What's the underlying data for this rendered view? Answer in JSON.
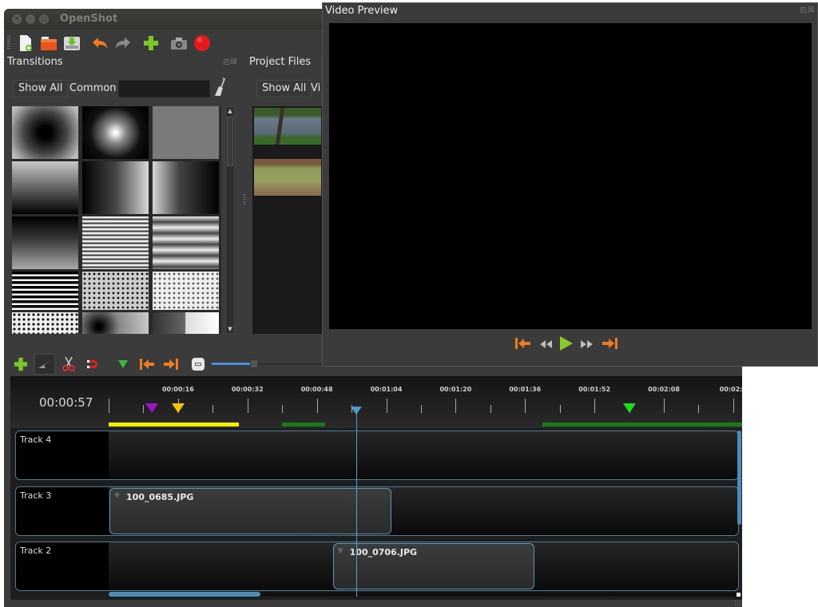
{
  "main_window": {
    "title": "OpenShot",
    "window_buttons": [
      "close",
      "minimize",
      "maximize"
    ],
    "toolbar": [
      {
        "name": "new-project-icon",
        "glyph": "📄"
      },
      {
        "name": "open-project-icon",
        "glyph": "📂"
      },
      {
        "name": "save-project-icon",
        "glyph": "⬇"
      },
      {
        "name": "undo-icon",
        "glyph": "↶"
      },
      {
        "name": "redo-icon",
        "glyph": "↷"
      },
      {
        "name": "import-files-icon",
        "glyph": "✚"
      },
      {
        "name": "export-snapshot-icon",
        "glyph": "📷"
      },
      {
        "name": "export-video-icon",
        "glyph": "●"
      }
    ]
  },
  "transitions_panel": {
    "title": "Transitions",
    "filter_show_all": "Show All",
    "filter_common": "Common",
    "search_value": "",
    "clear_icon": "broom-icon"
  },
  "project_files_panel": {
    "title": "Project Files",
    "filter_show_all": "Show All",
    "filter_video_truncated": "Vi",
    "files": [
      "pond-scene",
      "field-fence-scene"
    ]
  },
  "video_preview": {
    "title": "Video Preview",
    "controls": [
      "jump-to-start",
      "rewind",
      "play",
      "fast-forward",
      "jump-to-end"
    ]
  },
  "timeline_toolbar": {
    "zoom_level": 0.35
  },
  "timeline": {
    "current_time": "00:00:57",
    "playhead_seconds": 57,
    "ruler_labels": [
      "00:00:16",
      "00:00:32",
      "00:00:48",
      "00:01:04",
      "00:01:20",
      "00:01:36",
      "00:01:52",
      "00:02:08",
      "00:02:2"
    ],
    "ruler_label_seconds": [
      16,
      32,
      48,
      64,
      80,
      96,
      112,
      128,
      144
    ],
    "markers": [
      {
        "seconds": 10,
        "color": "#9b14c8"
      },
      {
        "seconds": 16,
        "color": "#f5c400"
      },
      {
        "seconds": 120,
        "color": "#19e01e"
      }
    ],
    "ranges": [
      {
        "start": 0,
        "end": 30,
        "color": "#f5f000"
      },
      {
        "start": 40,
        "end": 50,
        "color": "#1a7a1a"
      },
      {
        "start": 100,
        "end": 146,
        "color": "#1a7a1a"
      }
    ],
    "tracks": [
      {
        "name": "Track 4",
        "clips": []
      },
      {
        "name": "Track 3",
        "clips": [
          {
            "name": "100_0685.JPG",
            "start": 0,
            "end": 65
          }
        ]
      },
      {
        "name": "Track 2",
        "clips": [
          {
            "name": "100_0706.JPG",
            "start": 51.5,
            "end": 98
          }
        ]
      }
    ]
  }
}
